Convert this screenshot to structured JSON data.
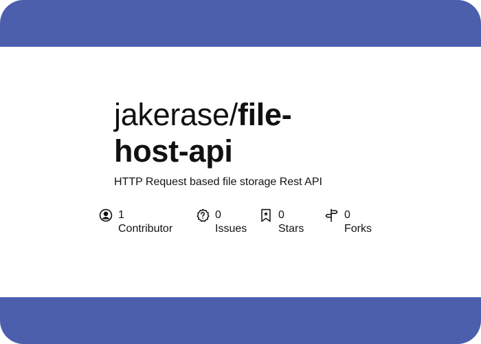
{
  "repo": {
    "owner": "jakerase/",
    "name": "file-host-api",
    "description": "HTTP Request based file storage Rest API"
  },
  "stats": {
    "contributors": {
      "count": "1",
      "label": "Contributor",
      "icon": "person-circle-icon"
    },
    "issues": {
      "count": "0",
      "label": "Issues",
      "icon": "issue-question-icon"
    },
    "stars": {
      "count": "0",
      "label": "Stars",
      "icon": "bookmark-star-icon"
    },
    "forks": {
      "count": "0",
      "label": "Forks",
      "icon": "signpost-fork-icon"
    }
  },
  "colors": {
    "band": "#4c5fad",
    "background": "#ffffff",
    "text": "#111111"
  }
}
